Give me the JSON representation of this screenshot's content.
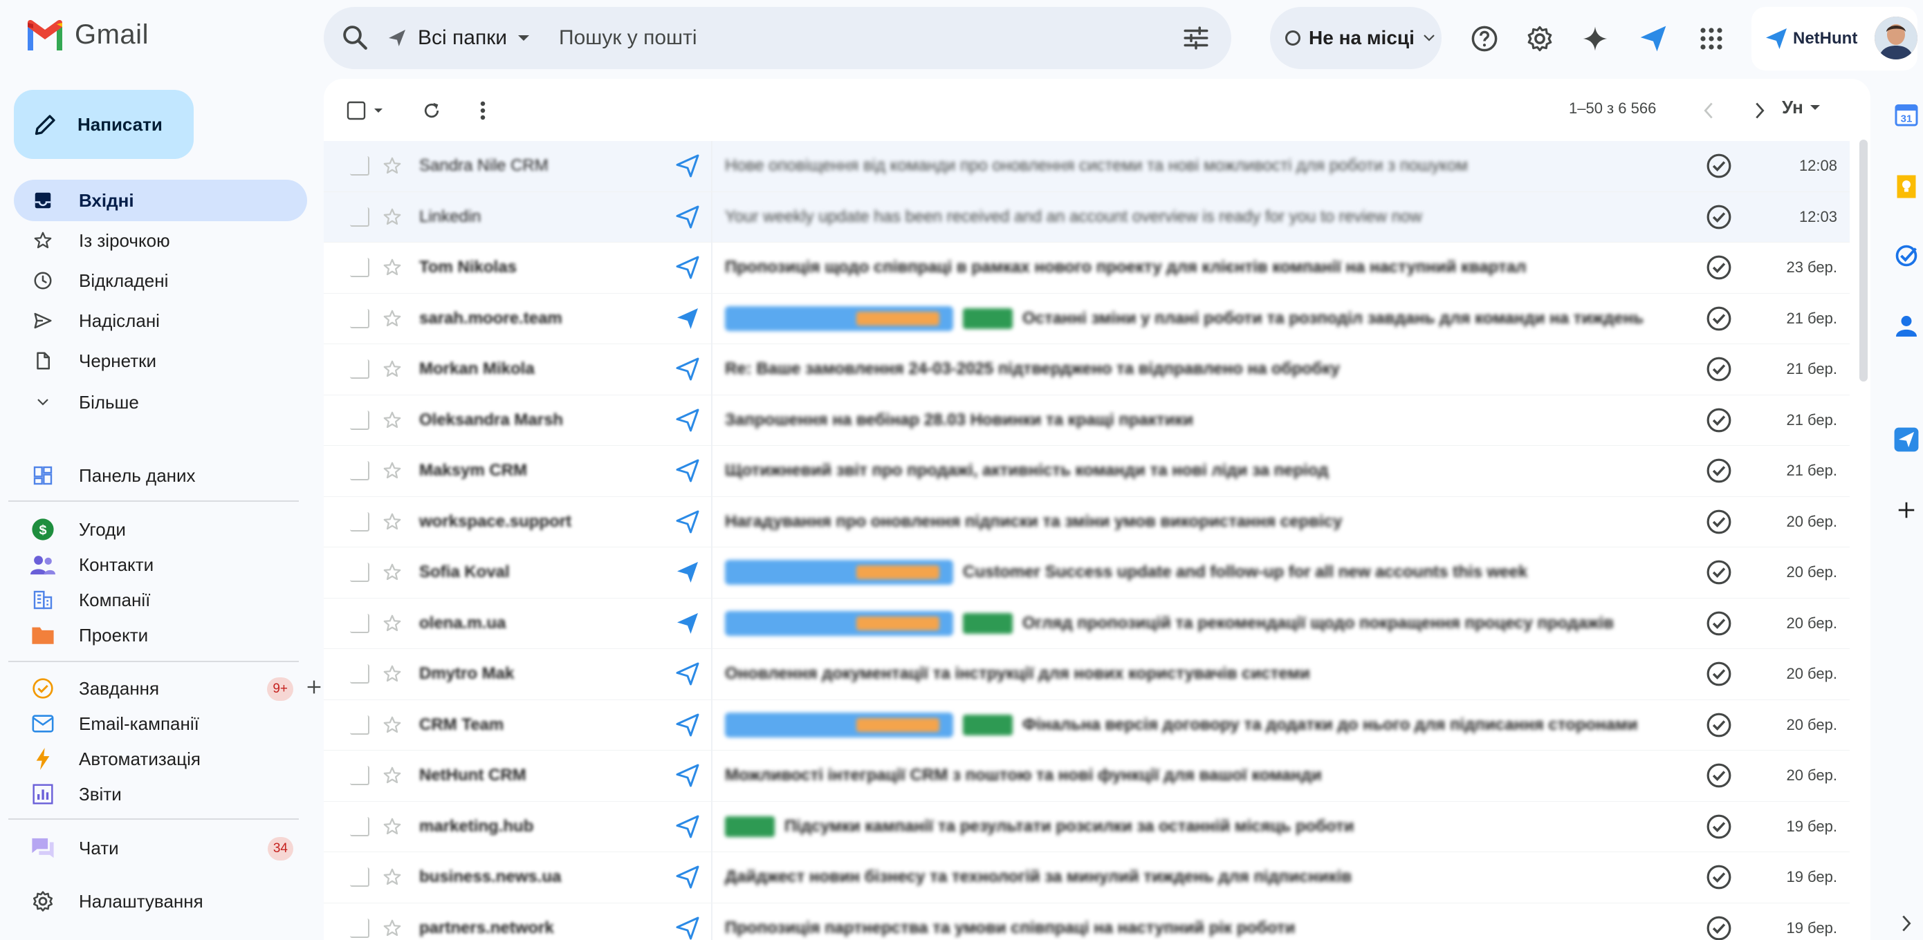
{
  "app": {
    "name": "Gmail"
  },
  "search": {
    "folder_label": "Всі папки",
    "placeholder": "Пошук у пошті"
  },
  "status": {
    "label": "Не на місці"
  },
  "brand": {
    "nethunt": "NetHunt"
  },
  "sidebar": {
    "compose_label": "Написати",
    "mail_items": [
      {
        "label": "Вхідні",
        "icon": "inbox-icon",
        "active": true
      },
      {
        "label": "Із зірочкою",
        "icon": "star-icon"
      },
      {
        "label": "Відкладені",
        "icon": "clock-icon"
      },
      {
        "label": "Надіслані",
        "icon": "send-icon"
      },
      {
        "label": "Чернетки",
        "icon": "draft-icon"
      },
      {
        "label": "Більше",
        "icon": "chevron-down-icon"
      }
    ],
    "dashboard_label": "Панель даних",
    "crm_items": [
      {
        "label": "Угоди",
        "icon": "deals-icon"
      },
      {
        "label": "Контакти",
        "icon": "contacts-icon"
      },
      {
        "label": "Компанії",
        "icon": "companies-icon"
      },
      {
        "label": "Проекти",
        "icon": "projects-icon"
      }
    ],
    "work_items": [
      {
        "label": "Завдання",
        "icon": "tasks-icon",
        "badge": "9+"
      },
      {
        "label": "Email-кампанії",
        "icon": "campaign-icon"
      },
      {
        "label": "Автоматизація",
        "icon": "automation-icon"
      },
      {
        "label": "Звіти",
        "icon": "reports-icon"
      }
    ],
    "chats": {
      "label": "Чати",
      "badge": "34"
    },
    "settings": {
      "label": "Налаштування"
    }
  },
  "toolbar": {
    "pagination": "1–50 з 6 566",
    "lang": "Ун"
  },
  "colors": {
    "accent": "#0b57d0",
    "compose_bg": "#c2e7ff",
    "active_nav": "#d3e3fd",
    "nethunt_blue": "#2b8ae6"
  },
  "emails": [
    {
      "sender": "Sandra Nile CRM",
      "subject": "Нове оповіщення від команди про оновлення системи та нові можливості для роботи з пошуком",
      "date": "12:08",
      "read": true,
      "nh": "outline"
    },
    {
      "sender": "Linkedin",
      "subject": "Your weekly update has been received and an account overview is ready for you to review now",
      "date": "12:03",
      "read": true,
      "nh": "outline"
    },
    {
      "sender": "Tom Nikolas",
      "subject": "Пропозиція щодо співпраці в рамках нового проекту для клієнтів компанії на наступний квартал",
      "date": "23 бер.",
      "read": false,
      "nh": "outline"
    },
    {
      "sender": "sarah.moore.team",
      "subject": "Останні зміни у плані роботи та розподіл завдань для команди на тиждень",
      "date": "21 бер.",
      "read": false,
      "nh": "filled",
      "tags": "blue-green"
    },
    {
      "sender": "Morkan Mikola",
      "subject": "Re: Ваше замовлення 24-03-2025 підтверджено та відправлено на обробку",
      "date": "21 бер.",
      "read": false,
      "nh": "outline"
    },
    {
      "sender": "Oleksandra Marsh",
      "subject": "Запрошення на вебінар 28.03 Новинки та кращі практики",
      "date": "21 бер.",
      "read": false,
      "nh": "outline"
    },
    {
      "sender": "Maksym CRM",
      "subject": "Щотижневий звіт про продажі, активність команди та нові ліди за період",
      "date": "21 бер.",
      "read": false,
      "nh": "outline"
    },
    {
      "sender": "workspace.support",
      "subject": "Нагадування про оновлення підписки та зміни умов використання сервісу",
      "date": "20 бер.",
      "read": false,
      "nh": "outline"
    },
    {
      "sender": "Sofia Koval",
      "subject": "Customer Success update and follow-up for all new accounts this week",
      "date": "20 бер.",
      "read": false,
      "nh": "filled",
      "tags": "blue"
    },
    {
      "sender": "olena.m.ua",
      "subject": "Огляд пропозицій та рекомендації щодо покращення процесу продажів",
      "date": "20 бер.",
      "read": false,
      "nh": "filled",
      "tags": "blue-green"
    },
    {
      "sender": "Dmytro Mak",
      "subject": "Оновлення документації та інструкції для нових користувачів системи",
      "date": "20 бер.",
      "read": false,
      "nh": "outline"
    },
    {
      "sender": "CRM Team",
      "subject": "Фінальна версія договору та додатки до нього для підписання сторонами",
      "date": "20 бер.",
      "read": false,
      "nh": "outline",
      "tags": "blue-green"
    },
    {
      "sender": "NetHunt CRM",
      "subject": "Можливості інтеграції CRM з поштою та нові функції для вашої команди",
      "date": "20 бер.",
      "read": false,
      "nh": "outline"
    },
    {
      "sender": "marketing.hub",
      "subject": "Підсумки кампанії та результати розсилки за останній місяць роботи",
      "date": "19 бер.",
      "read": false,
      "nh": "outline",
      "tags": "green"
    },
    {
      "sender": "business.news.ua",
      "subject": "Дайджест новин бізнесу та технологій за минулий тиждень для підписників",
      "date": "19 бер.",
      "read": false,
      "nh": "outline"
    },
    {
      "sender": "partners.network",
      "subject": "Пропозиція партнерства та умови співпраці на наступний рік роботи",
      "date": "19 бер.",
      "read": false,
      "nh": "outline"
    }
  ]
}
